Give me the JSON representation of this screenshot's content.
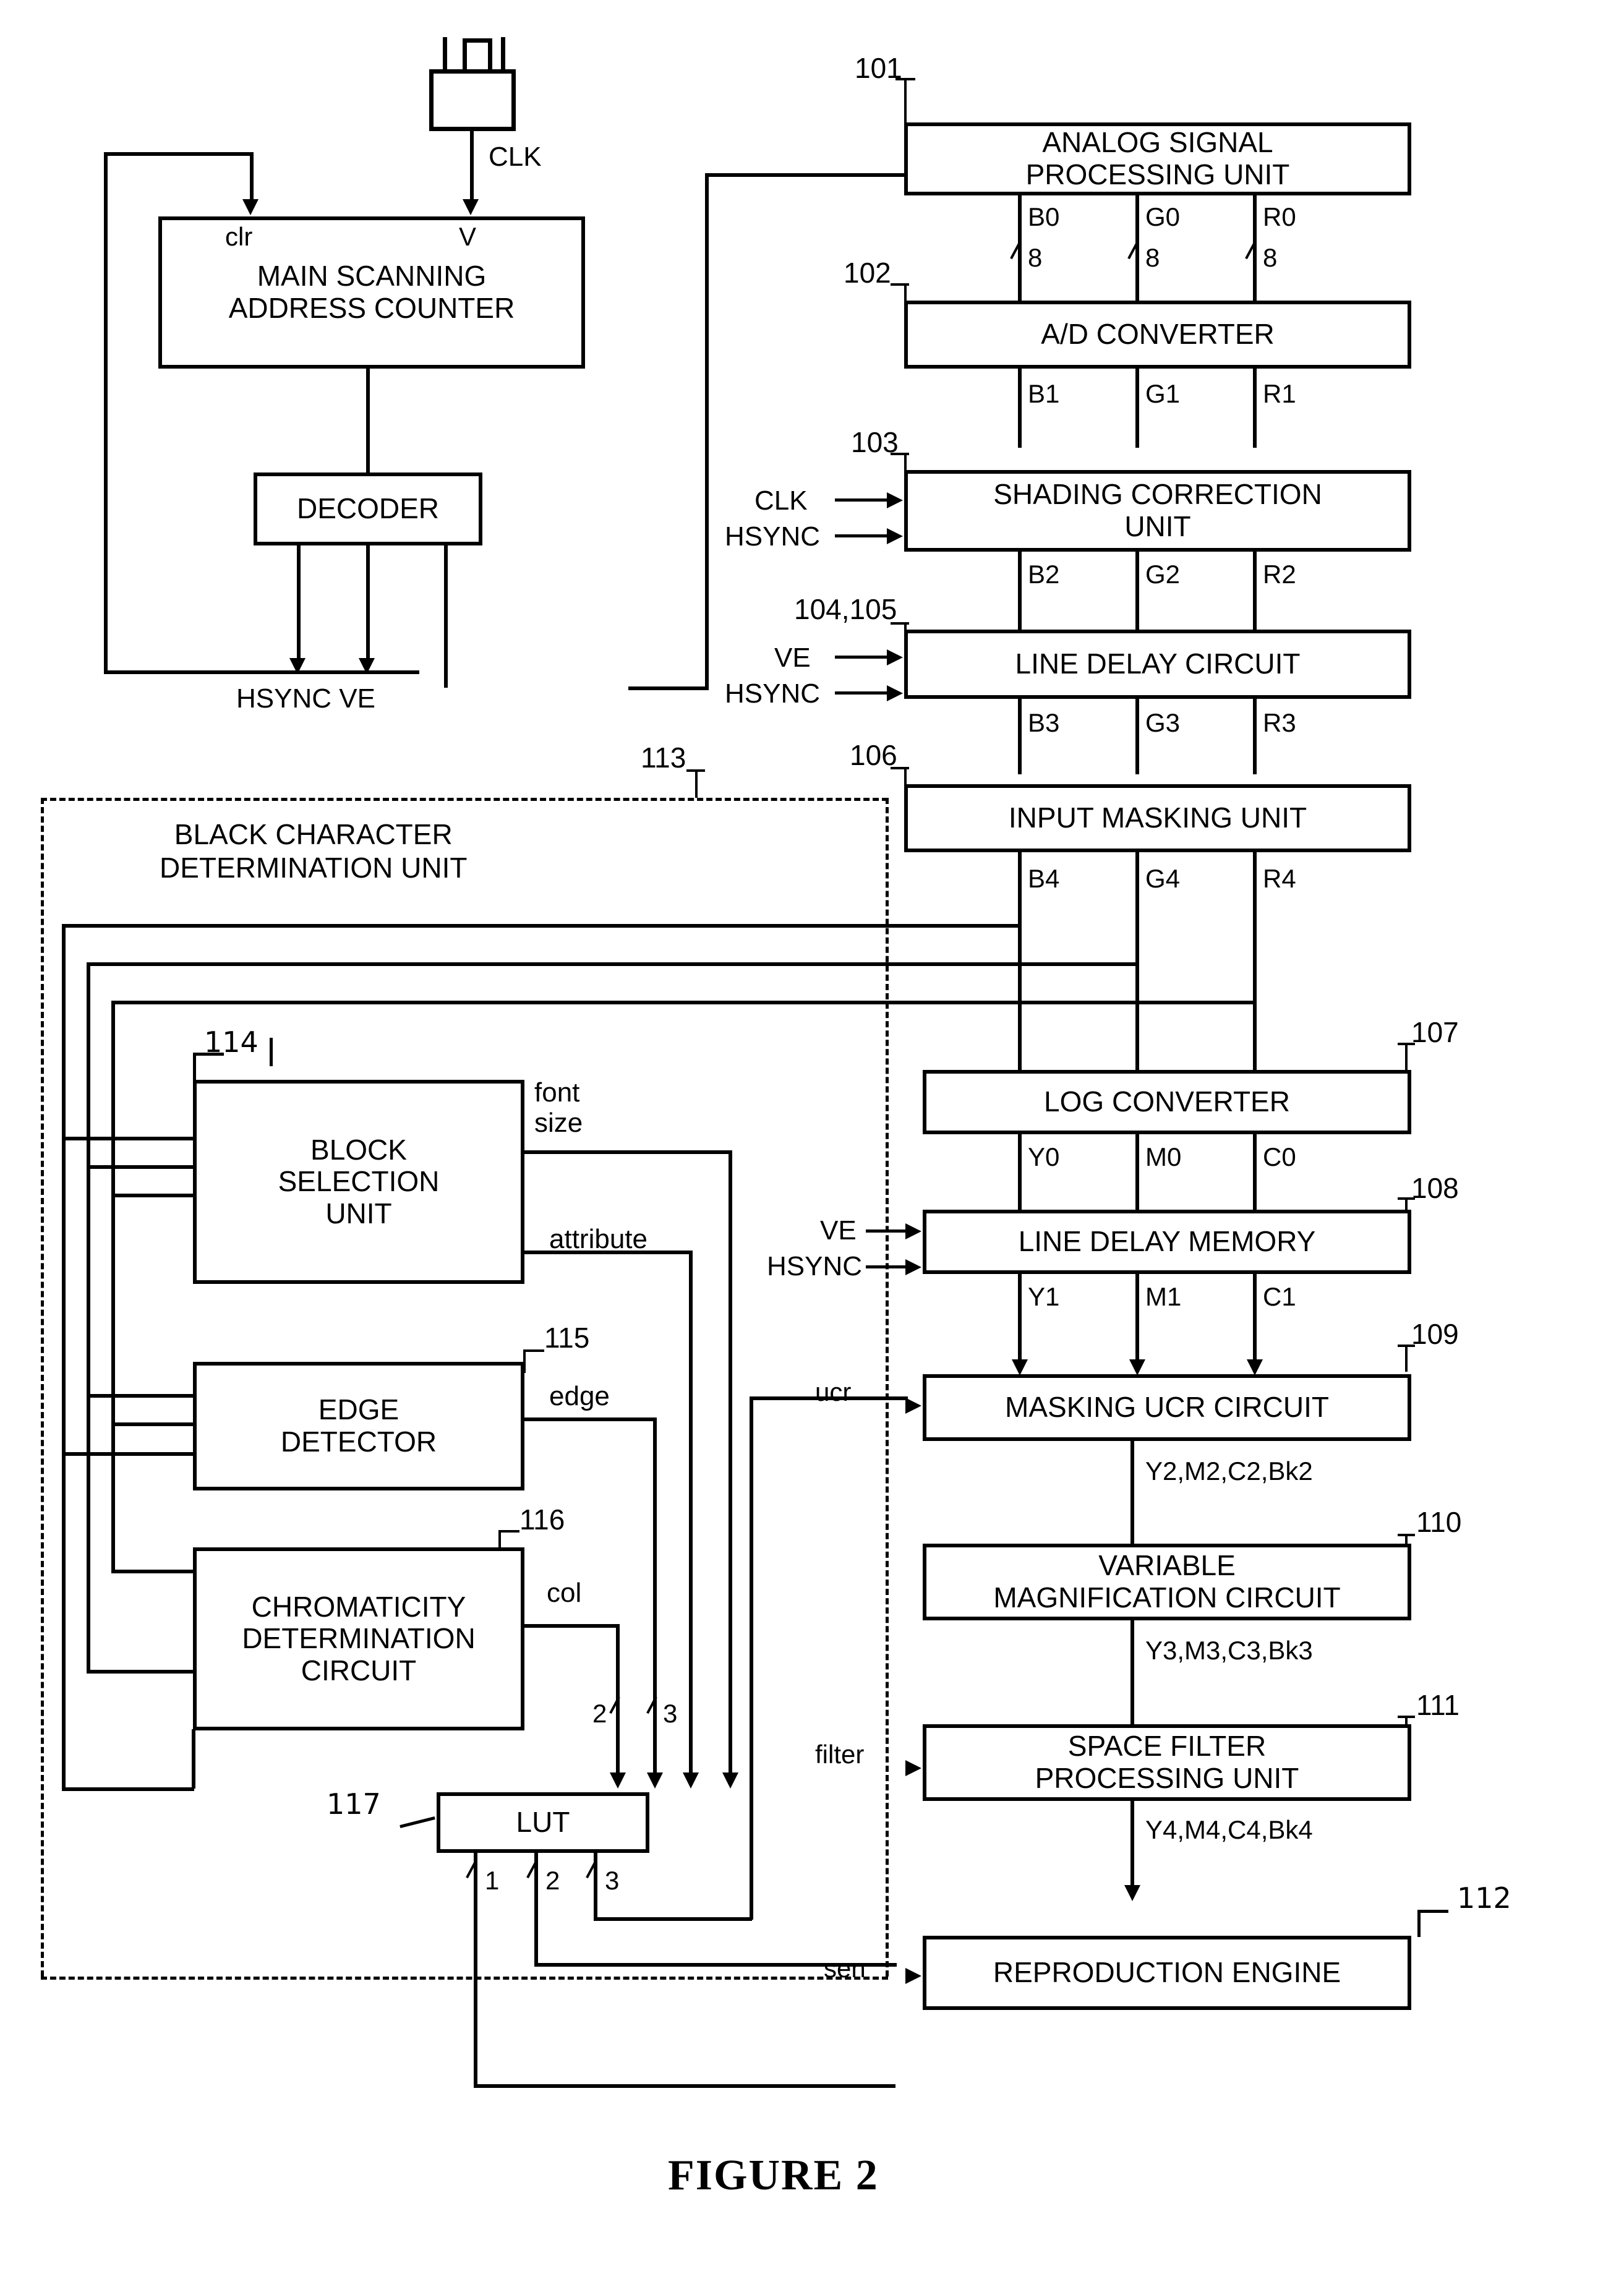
{
  "figure": {
    "caption": "FIGURE 2"
  },
  "refnums": {
    "n101": "101",
    "n102": "102",
    "n103": "103",
    "n104_105": "104,105",
    "n106": "106",
    "n107": "107",
    "n108": "108",
    "n109": "109",
    "n110": "110",
    "n111": "111",
    "n112": "112",
    "n113": "113",
    "n114": "114",
    "n115": "115",
    "n116": "116",
    "n117": "117"
  },
  "blocks": {
    "analog_signal_processing_unit": "ANALOG SIGNAL\nPROCESSING UNIT",
    "ad_converter": "A/D CONVERTER",
    "shading_correction_unit": "SHADING CORRECTION\nUNIT",
    "line_delay_circuit": "LINE DELAY CIRCUIT",
    "input_masking_unit": "INPUT MASKING UNIT",
    "log_converter": "LOG CONVERTER",
    "line_delay_memory": "LINE DELAY MEMORY",
    "masking_ucr_circuit": "MASKING UCR CIRCUIT",
    "variable_magnification_circuit": "VARIABLE\nMAGNIFICATION CIRCUIT",
    "space_filter_processing_unit": "SPACE FILTER\nPROCESSING UNIT",
    "reproduction_engine": "REPRODUCTION ENGINE",
    "main_scanning_address_counter": "MAIN SCANNING\nADDRESS COUNTER",
    "decoder": "DECODER",
    "block_selection_unit": "BLOCK\nSELECTION\nUNIT",
    "edge_detector": "EDGE\nDETECTOR",
    "chromaticity_determination_circuit": "CHROMATICITY\nDETERMINATION\nCIRCUIT",
    "lut": "LUT",
    "black_character_determination_unit": "BLACK CHARACTER\nDETERMINATION UNIT"
  },
  "bus_labels": {
    "row0": [
      "B0",
      "G0",
      "R0"
    ],
    "row0_width": [
      "8",
      "8",
      "8"
    ],
    "row1": [
      "B1",
      "G1",
      "R1"
    ],
    "row2": [
      "B2",
      "G2",
      "R2"
    ],
    "row3": [
      "B3",
      "G3",
      "R3"
    ],
    "row4": [
      "B4",
      "G4",
      "R4"
    ],
    "cmy0": [
      "Y0",
      "M0",
      "C0"
    ],
    "cmy1": [
      "Y1",
      "M1",
      "C1"
    ],
    "ymcbk2": "Y2,M2,C2,Bk2",
    "ymcbk3": "Y3,M3,C3,Bk3",
    "ymcbk4": "Y4,M4,C4,Bk4"
  },
  "signals": {
    "clk": "CLK",
    "hsync": "HSYNC",
    "ve": "VE",
    "clr_pin": "clr",
    "v_pin": "V",
    "hsync_ve_out": "HSYNC VE",
    "font_size": "font\nsize",
    "attribute": "attribute",
    "edge": "edge",
    "col": "col",
    "ucr": "ucr",
    "filter": "filter",
    "sen": "sen"
  },
  "lut_inputs": [
    "2",
    "3"
  ],
  "lut_outputs": [
    "1",
    "2",
    "3"
  ],
  "colors": {
    "ink": "#000000",
    "paper": "#ffffff"
  }
}
